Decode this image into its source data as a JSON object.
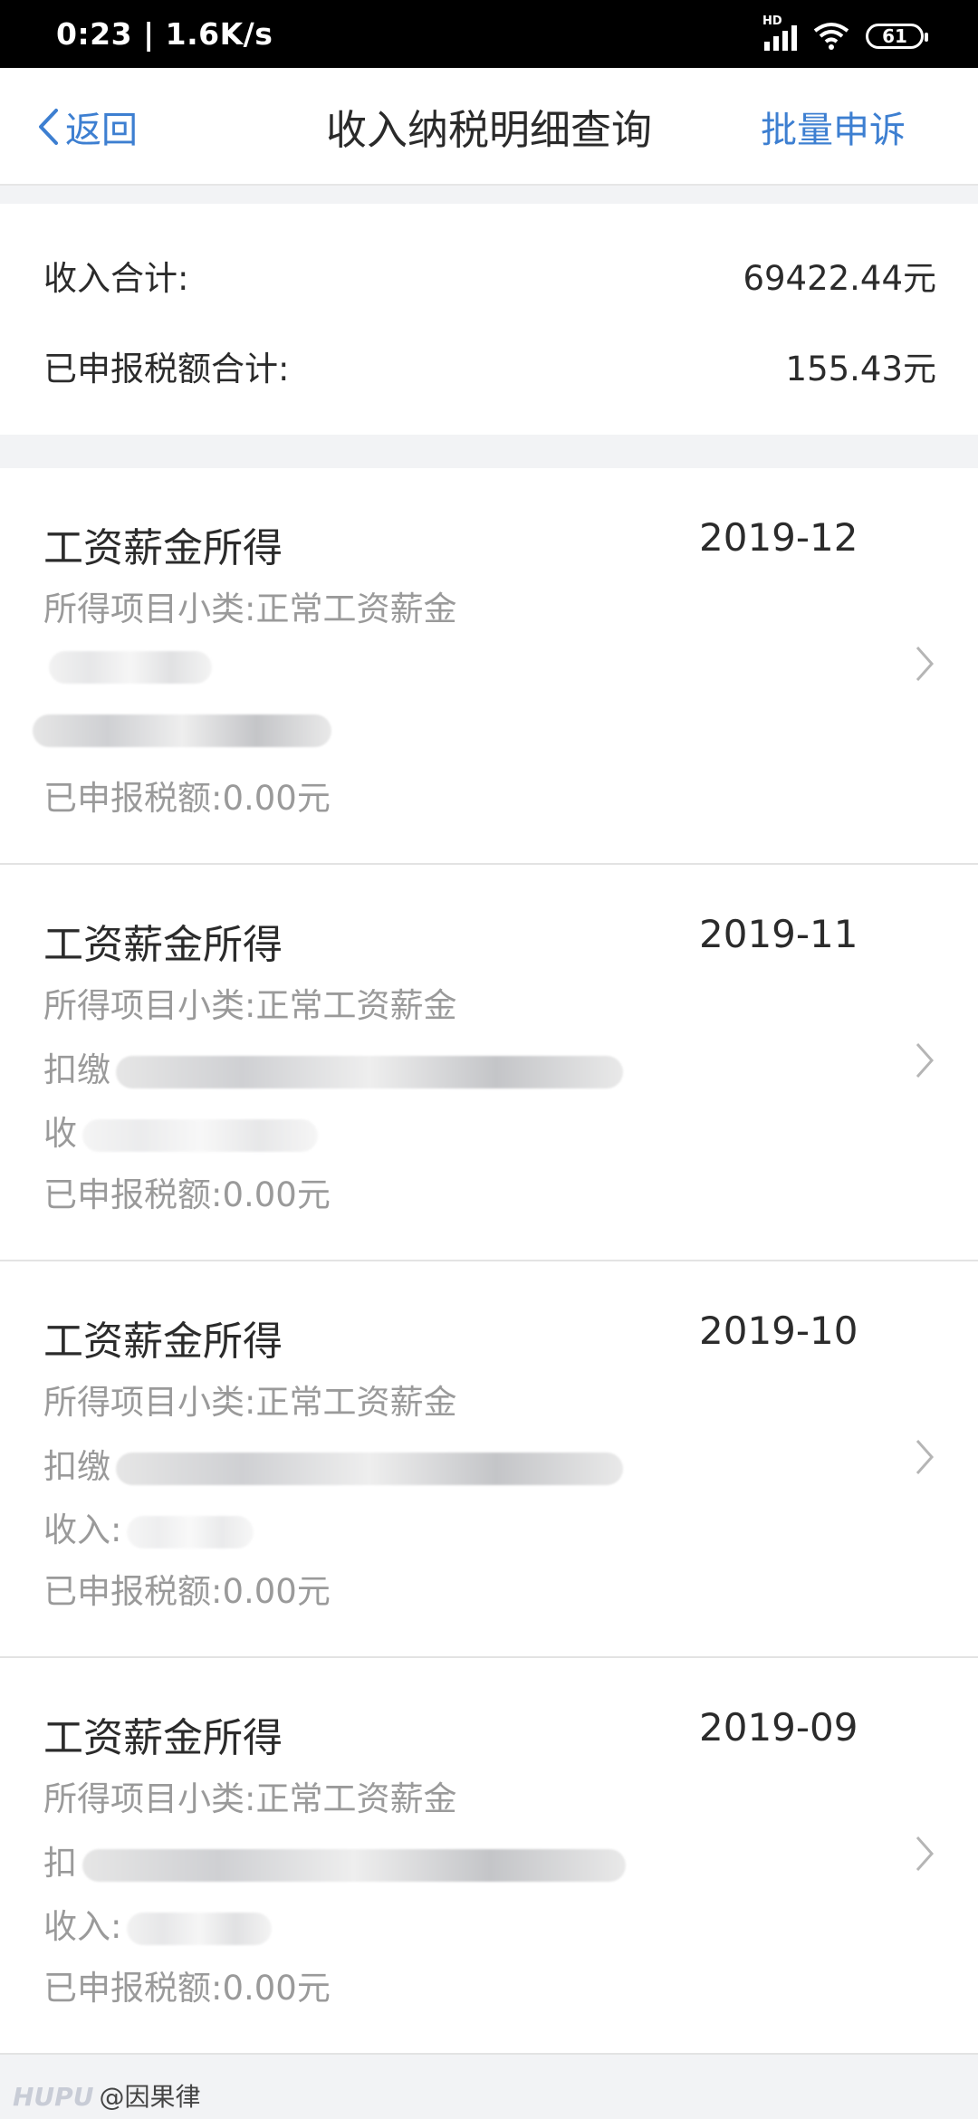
{
  "status_bar": {
    "time": "0:23 | 1.6K/s",
    "network_badge": "HD",
    "battery": "61"
  },
  "nav": {
    "back_label": "返回",
    "title": "收入纳税明细查询",
    "action_label": "批量申诉"
  },
  "summary": {
    "income_label": "收入合计:",
    "income_value": "69422.44元",
    "tax_label": "已申报税额合计:",
    "tax_value": "155.43元"
  },
  "records": [
    {
      "title": "工资薪金所得",
      "date": "2019-12",
      "subcategory": "所得项目小类:正常工资薪金",
      "payer_label": "",
      "income_label": "",
      "tax": "已申报税额:0.00元"
    },
    {
      "title": "工资薪金所得",
      "date": "2019-11",
      "subcategory": "所得项目小类:正常工资薪金",
      "payer_label": "扣缴",
      "income_label": "收",
      "tax": "已申报税额:0.00元"
    },
    {
      "title": "工资薪金所得",
      "date": "2019-10",
      "subcategory": "所得项目小类:正常工资薪金",
      "payer_label": "扣缴",
      "income_label": "收入:",
      "tax": "已申报税额:0.00元"
    },
    {
      "title": "工资薪金所得",
      "date": "2019-09",
      "subcategory": "所得项目小类:正常工资薪金",
      "payer_label": "扣",
      "income_label": "收入:",
      "tax": "已申报税额:0.00元"
    }
  ],
  "watermark": {
    "brand": "HUPU",
    "user": "@因果律"
  }
}
